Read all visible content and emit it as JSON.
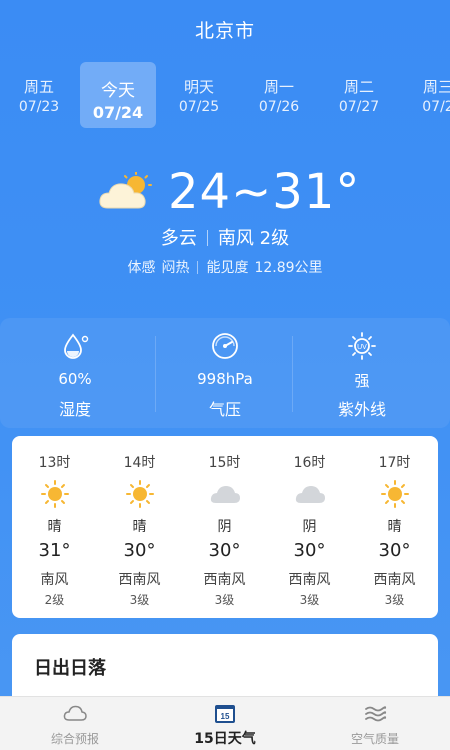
{
  "header": {
    "city": "北京市"
  },
  "days": [
    {
      "name": "周五",
      "date": "07/23",
      "active": false
    },
    {
      "name": "今天",
      "date": "07/24",
      "active": true
    },
    {
      "name": "明天",
      "date": "07/25",
      "active": false
    },
    {
      "name": "周一",
      "date": "07/26",
      "active": false
    },
    {
      "name": "周二",
      "date": "07/27",
      "active": false
    },
    {
      "name": "周三",
      "date": "07/2",
      "active": false
    }
  ],
  "current": {
    "temp": "24~31°",
    "condition": "多云",
    "wind": "南风 2级",
    "feel_label": "体感",
    "feel_value": "闷热",
    "visibility_label": "能见度",
    "visibility_value": "12.89公里",
    "icon": "partly-cloudy-icon"
  },
  "stats": [
    {
      "value": "60%",
      "label": "湿度",
      "icon": "humidity-icon"
    },
    {
      "value": "998hPa",
      "label": "气压",
      "icon": "pressure-icon"
    },
    {
      "value": "强",
      "label": "紫外线",
      "icon": "uv-icon"
    }
  ],
  "hourly": [
    {
      "time": "13时",
      "icon": "sun-icon",
      "condition": "晴",
      "temp": "31°",
      "wind": "南风",
      "level": "2级"
    },
    {
      "time": "14时",
      "icon": "sun-icon",
      "condition": "晴",
      "temp": "30°",
      "wind": "西南风",
      "level": "3级"
    },
    {
      "time": "15时",
      "icon": "cloud-icon",
      "condition": "阴",
      "temp": "30°",
      "wind": "西南风",
      "level": "3级"
    },
    {
      "time": "16时",
      "icon": "cloud-icon",
      "condition": "阴",
      "temp": "30°",
      "wind": "西南风",
      "level": "3级"
    },
    {
      "time": "17时",
      "icon": "sun-icon",
      "condition": "晴",
      "temp": "30°",
      "wind": "西南风",
      "level": "3级"
    }
  ],
  "sun_card": {
    "title": "日出日落"
  },
  "tabs": [
    {
      "label": "综合预报",
      "icon": "cloud-outline-icon",
      "active": false
    },
    {
      "label": "15日天气",
      "icon": "calendar-15-icon",
      "active": true
    },
    {
      "label": "空气质量",
      "icon": "wind-waves-icon",
      "active": false
    }
  ],
  "colors": {
    "background": "#3f8ef3",
    "sun": "#f7b733",
    "cloud_gray": "#d3d6da",
    "tab_active": "#222222",
    "tab_inactive": "#999999"
  }
}
